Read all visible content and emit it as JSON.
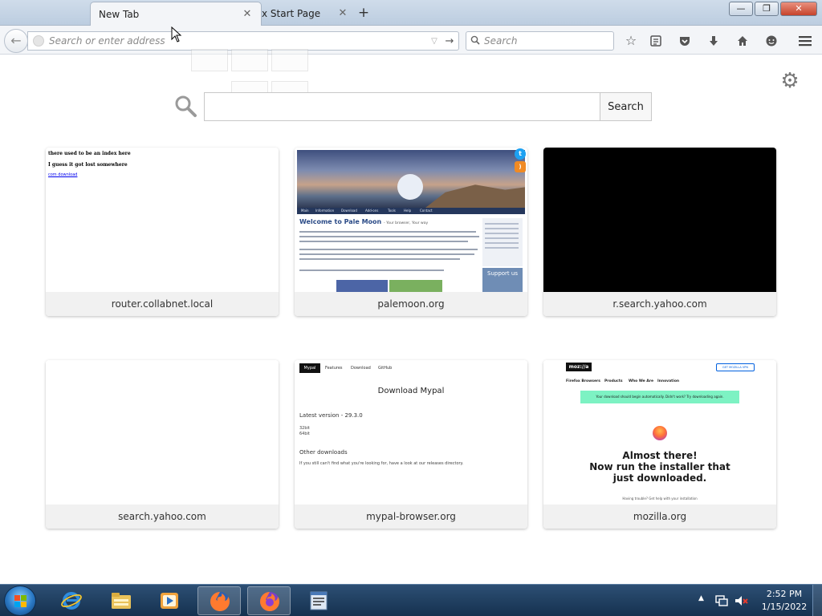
{
  "tabs": [
    {
      "title": "New Tab",
      "active": true
    },
    {
      "title": "x Start Page",
      "active": false
    }
  ],
  "tab_close_glyph": "✕",
  "new_tab_glyph": "+",
  "window_buttons": {
    "minimize": "—",
    "maximize": "❐",
    "close": "✕"
  },
  "urlbar": {
    "placeholder": "Search or enter address",
    "value": "",
    "go_glyph": "→",
    "dropdown_glyph": "▽"
  },
  "searchbar": {
    "placeholder": "Search",
    "icon": "search-icon"
  },
  "toolbar_icons": [
    "bookmark-star-icon",
    "reading-list-icon",
    "pocket-icon",
    "downloads-icon",
    "home-icon",
    "chat-icon",
    "menu-icon"
  ],
  "page_search": {
    "placeholder": "",
    "button_label": "Search"
  },
  "tiles": [
    {
      "title": "router.collabnet.local",
      "thumb": "router",
      "lines": [
        "there used to be an index here",
        "I guess it got lost somewhere"
      ],
      "link": "com download"
    },
    {
      "title": "palemoon.org",
      "thumb": "palemoon",
      "heading": "Welcome to Pale Moon",
      "tagline": "- Your browser, Your way",
      "nav": [
        "Main",
        "Information",
        "Download",
        "Add-ons",
        "Tools",
        "Help",
        "Contact"
      ],
      "support": "Support us"
    },
    {
      "title": "r.search.yahoo.com",
      "thumb": "black"
    },
    {
      "title": "search.yahoo.com",
      "thumb": "blank"
    },
    {
      "title": "mypal-browser.org",
      "thumb": "mypal",
      "logo": "Mypal",
      "nav": [
        "Features",
        "Download",
        "GitHub"
      ],
      "heading": "Download Mypal",
      "version": "Latest version - 29.3.0",
      "builds": [
        "32bit",
        "64bit"
      ],
      "other": "Other downloads",
      "other_text": "If you still can't find what you're looking for, have a look at our releases directory."
    },
    {
      "title": "mozilla.org",
      "thumb": "mozilla",
      "logo": "moz://a",
      "cta": "GET MOZILLA VPN",
      "nav": [
        "Firefox Browsers",
        "Products",
        "Who We Are",
        "Innovation"
      ],
      "banner": "Your download should begin automatically. Didn't work? Try downloading again.",
      "message": [
        "Almost there!",
        "Now run the installer that",
        "just downloaded."
      ],
      "footer": "Having trouble? Get help with your installation"
    }
  ],
  "taskbar": {
    "items": [
      {
        "name": "internet-explorer-icon",
        "color": "#2e8de0"
      },
      {
        "name": "file-explorer-icon",
        "color": "#e9c25a"
      },
      {
        "name": "media-player-icon",
        "color": "#f0a23c"
      },
      {
        "name": "firefox-icon",
        "color": "#ff7a2f"
      },
      {
        "name": "firefox-icon-2",
        "color": "#ff7a2f"
      },
      {
        "name": "notepad-icon",
        "color": "#dfe8f3"
      }
    ],
    "time": "2:52 PM",
    "date": "1/15/2022"
  }
}
